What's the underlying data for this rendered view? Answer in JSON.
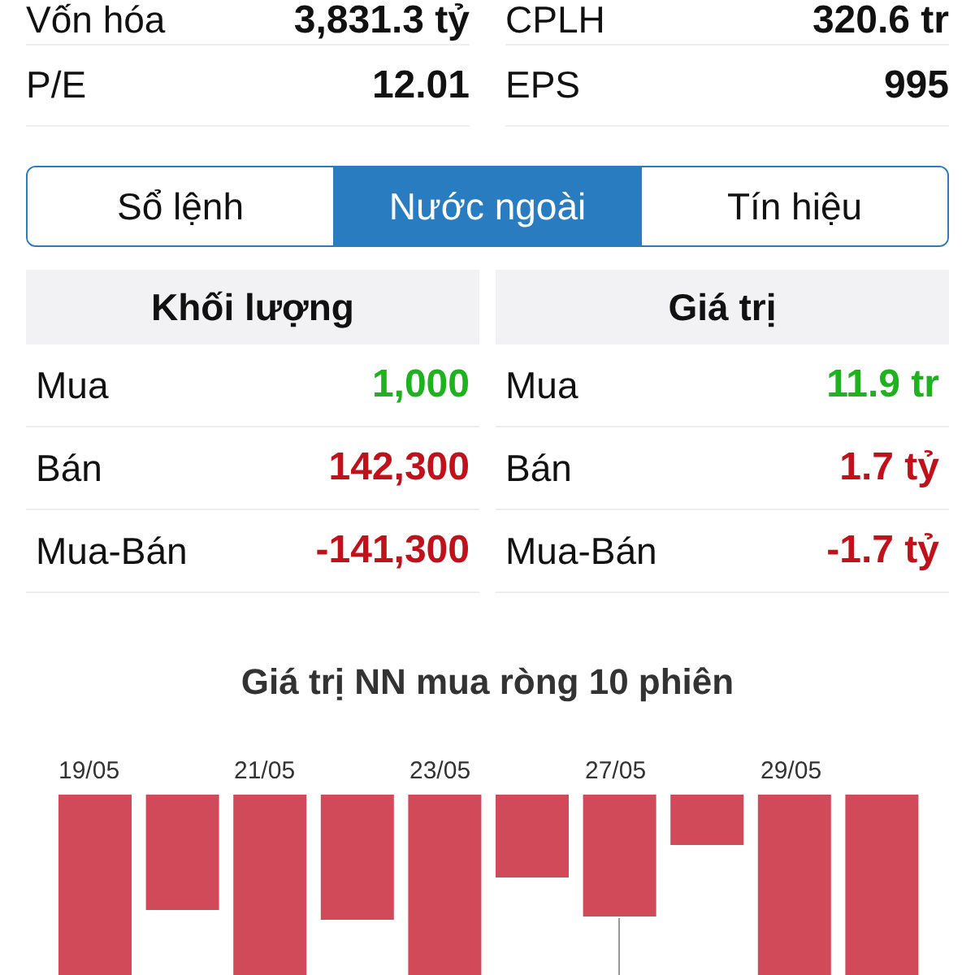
{
  "stats": [
    {
      "label": "Vốn hóa",
      "value": "3,831.3 tỷ"
    },
    {
      "label": "CPLH",
      "value": "320.6 tr"
    },
    {
      "label": "P/E",
      "value": "12.01"
    },
    {
      "label": "EPS",
      "value": "995"
    }
  ],
  "tabs": [
    {
      "label": "Sổ lệnh",
      "selected": false
    },
    {
      "label": "Nước ngoài",
      "selected": true
    },
    {
      "label": "Tín hiệu",
      "selected": false
    }
  ],
  "tables": [
    {
      "title": "Khối lượng",
      "rows": [
        {
          "label": "Mua",
          "value": "1,000",
          "kind": "up"
        },
        {
          "label": "Bán",
          "value": "142,300",
          "kind": "down"
        },
        {
          "label": "Mua-Bán",
          "value": "-141,300",
          "kind": "down"
        }
      ]
    },
    {
      "title": "Giá trị",
      "rows": [
        {
          "label": "Mua",
          "value": "11.9 tr",
          "kind": "up"
        },
        {
          "label": "Bán",
          "value": "1.7 tỷ",
          "kind": "down"
        },
        {
          "label": "Mua-Bán",
          "value": "-1.7 tỷ",
          "kind": "down"
        }
      ]
    }
  ],
  "chart": {
    "title": "Giá trị NN mua ròng 10 phiên",
    "x_labels": [
      "19/05",
      "21/05",
      "23/05",
      "27/05",
      "29/05"
    ]
  }
}
